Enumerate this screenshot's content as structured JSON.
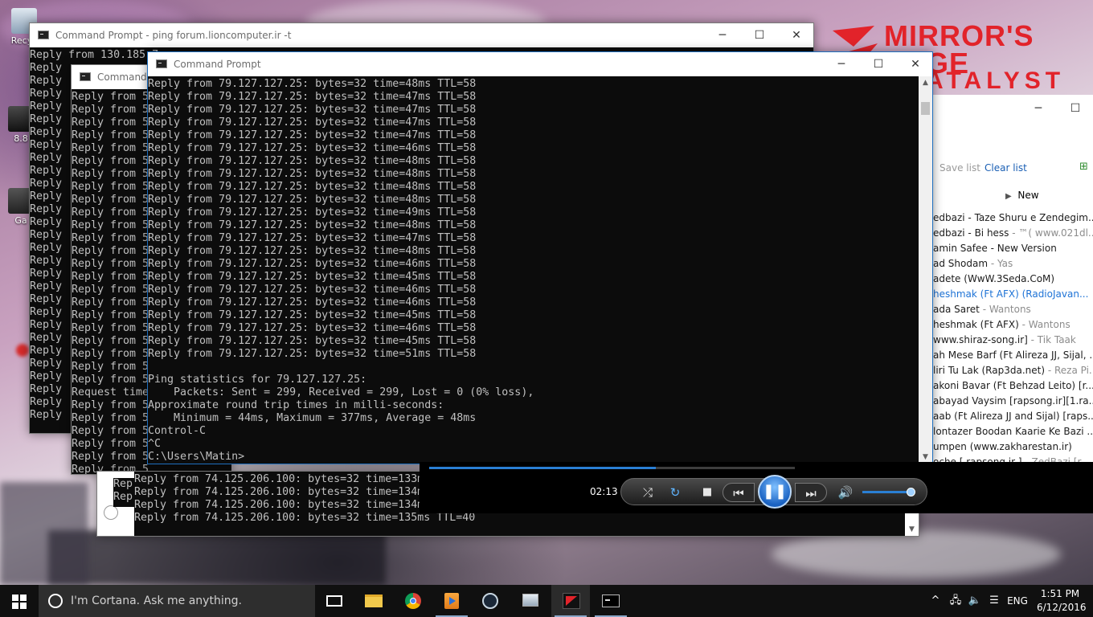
{
  "desktop": {
    "logo": {
      "line1": "MIRROR'S",
      "line2": "EDGE",
      "line3": "ATALYST",
      "tm": "™"
    },
    "icons": [
      {
        "label": "Recyc"
      },
      {
        "label": "8.8"
      },
      {
        "label": "Ga"
      }
    ]
  },
  "win_ping_lion": {
    "title": "Command Prompt - ping  forum.lioncomputer.ir -t",
    "lines": [
      "Reply from 130.185.7",
      "Reply ",
      "Reply ",
      "Reply ",
      "Reply ",
      "Reply ",
      "Reply ",
      "Reply ",
      "Reply ",
      "Reply ",
      "Reply ",
      "Reply ",
      "Reply ",
      "Reply ",
      "Reply ",
      "Reply ",
      "Reply ",
      "Reply ",
      "Reply ",
      "Reply ",
      "Reply ",
      "Reply ",
      "Reply ",
      "Reply ",
      "Reply ",
      "Reply ",
      "Reply ",
      "Reply ",
      "Reply "
    ]
  },
  "win_cmd_mid": {
    "title": "Command",
    "lines": [
      "Reply from 5",
      "Reply from 5",
      "Reply from 5",
      "Reply from 5",
      "Reply from 5",
      "Reply from 5",
      "Reply from 5",
      "Reply from 5",
      "Reply from 5",
      "Reply from 5",
      "Reply from 5",
      "Reply from 5",
      "Reply from 5",
      "Reply from 5",
      "Reply from 5",
      "Reply from 5",
      "Reply from 5",
      "Reply from 5",
      "Reply from 5",
      "Reply from 5",
      "Reply from 5",
      "Reply from 5",
      "Reply from 5",
      "Request time",
      "Reply from 5",
      "Reply from 5",
      "Reply from 5",
      "Reply from 5",
      "Reply from 5",
      "Reply from 5"
    ]
  },
  "win_cmd_front": {
    "title": "Command Prompt",
    "lines": [
      "Reply from 79.127.127.25: bytes=32 time=48ms TTL=58",
      "Reply from 79.127.127.25: bytes=32 time=47ms TTL=58",
      "Reply from 79.127.127.25: bytes=32 time=47ms TTL=58",
      "Reply from 79.127.127.25: bytes=32 time=47ms TTL=58",
      "Reply from 79.127.127.25: bytes=32 time=47ms TTL=58",
      "Reply from 79.127.127.25: bytes=32 time=46ms TTL=58",
      "Reply from 79.127.127.25: bytes=32 time=48ms TTL=58",
      "Reply from 79.127.127.25: bytes=32 time=48ms TTL=58",
      "Reply from 79.127.127.25: bytes=32 time=48ms TTL=58",
      "Reply from 79.127.127.25: bytes=32 time=48ms TTL=58",
      "Reply from 79.127.127.25: bytes=32 time=49ms TTL=58",
      "Reply from 79.127.127.25: bytes=32 time=48ms TTL=58",
      "Reply from 79.127.127.25: bytes=32 time=47ms TTL=58",
      "Reply from 79.127.127.25: bytes=32 time=48ms TTL=58",
      "Reply from 79.127.127.25: bytes=32 time=46ms TTL=58",
      "Reply from 79.127.127.25: bytes=32 time=45ms TTL=58",
      "Reply from 79.127.127.25: bytes=32 time=46ms TTL=58",
      "Reply from 79.127.127.25: bytes=32 time=46ms TTL=58",
      "Reply from 79.127.127.25: bytes=32 time=45ms TTL=58",
      "Reply from 79.127.127.25: bytes=32 time=46ms TTL=58",
      "Reply from 79.127.127.25: bytes=32 time=45ms TTL=58",
      "Reply from 79.127.127.25: bytes=32 time=51ms TTL=58",
      "",
      "Ping statistics for 79.127.127.25:",
      "    Packets: Sent = 299, Received = 299, Lost = 0 (0% loss),",
      "Approximate round trip times in milli-seconds:",
      "    Minimum = 44ms, Maximum = 377ms, Average = 48ms",
      "Control-C",
      "^C",
      "C:\\Users\\Matin>"
    ]
  },
  "win_cmd_bottom": {
    "lines": [
      "Reply from 74.125.206.100: bytes=32 time=133m",
      "Reply from 74.125.206.100: bytes=32 time=134m",
      "Reply from 74.125.206.100: bytes=32 time=134m",
      "Reply from 74.125.206.100: bytes=32 time=135ms TTL=40"
    ],
    "left_fragments": [
      "Rep",
      "Rep"
    ]
  },
  "player": {
    "save_list": "Save list",
    "clear_list": "Clear list",
    "new_label": "New",
    "time": "02:13",
    "seek_progress": 0.62,
    "volume_level": 0.92,
    "playlist": [
      {
        "title": "edbazi - Taze Shuru e Zendegim...",
        "artist": ""
      },
      {
        "title": "edbazi - Bi hess",
        "artist": " - ™( www.021dl...."
      },
      {
        "title": "amin Safee - New Version",
        "artist": ""
      },
      {
        "title": "ad Shodam",
        "artist": " - Yas"
      },
      {
        "title": "adete (WwW.3Seda.CoM)",
        "artist": ""
      },
      {
        "title": "heshmak (Ft AFX) (RadioJavan...",
        "artist": "",
        "selected": true
      },
      {
        "title": "ada Saret",
        "artist": " - Wantons"
      },
      {
        "title": "heshmak (Ft AFX)",
        "artist": " - Wantons"
      },
      {
        "title": "www.shiraz-song.ir]",
        "artist": " - Tik Taak"
      },
      {
        "title": "ah Mese Barf (Ft Alireza JJ, Sijal, ...",
        "artist": ""
      },
      {
        "title": "liri Tu Lak (Rap3da.net)",
        "artist": " - Reza Pi..."
      },
      {
        "title": "akoni Bavar (Ft Behzad Leito) [r...",
        "artist": ""
      },
      {
        "title": "abayad Vaysim [rapsong.ir][1.ra...",
        "artist": ""
      },
      {
        "title": "aab (Ft Alireza JJ and Sijal) [raps...",
        "artist": ""
      },
      {
        "title": "lontazer Boodan Kaarie Ke Bazi ...",
        "artist": ""
      },
      {
        "title": "umpen (www.zakharestan.ir)",
        "artist": ""
      },
      {
        "title": "oche [ rapsong.ir ]",
        "artist": " - ZedBazi [r..."
      }
    ]
  },
  "taskbar": {
    "cortana_placeholder": "I'm Cortana. Ask me anything.",
    "language": "ENG",
    "time": "1:51 PM",
    "date": "6/12/2016"
  }
}
